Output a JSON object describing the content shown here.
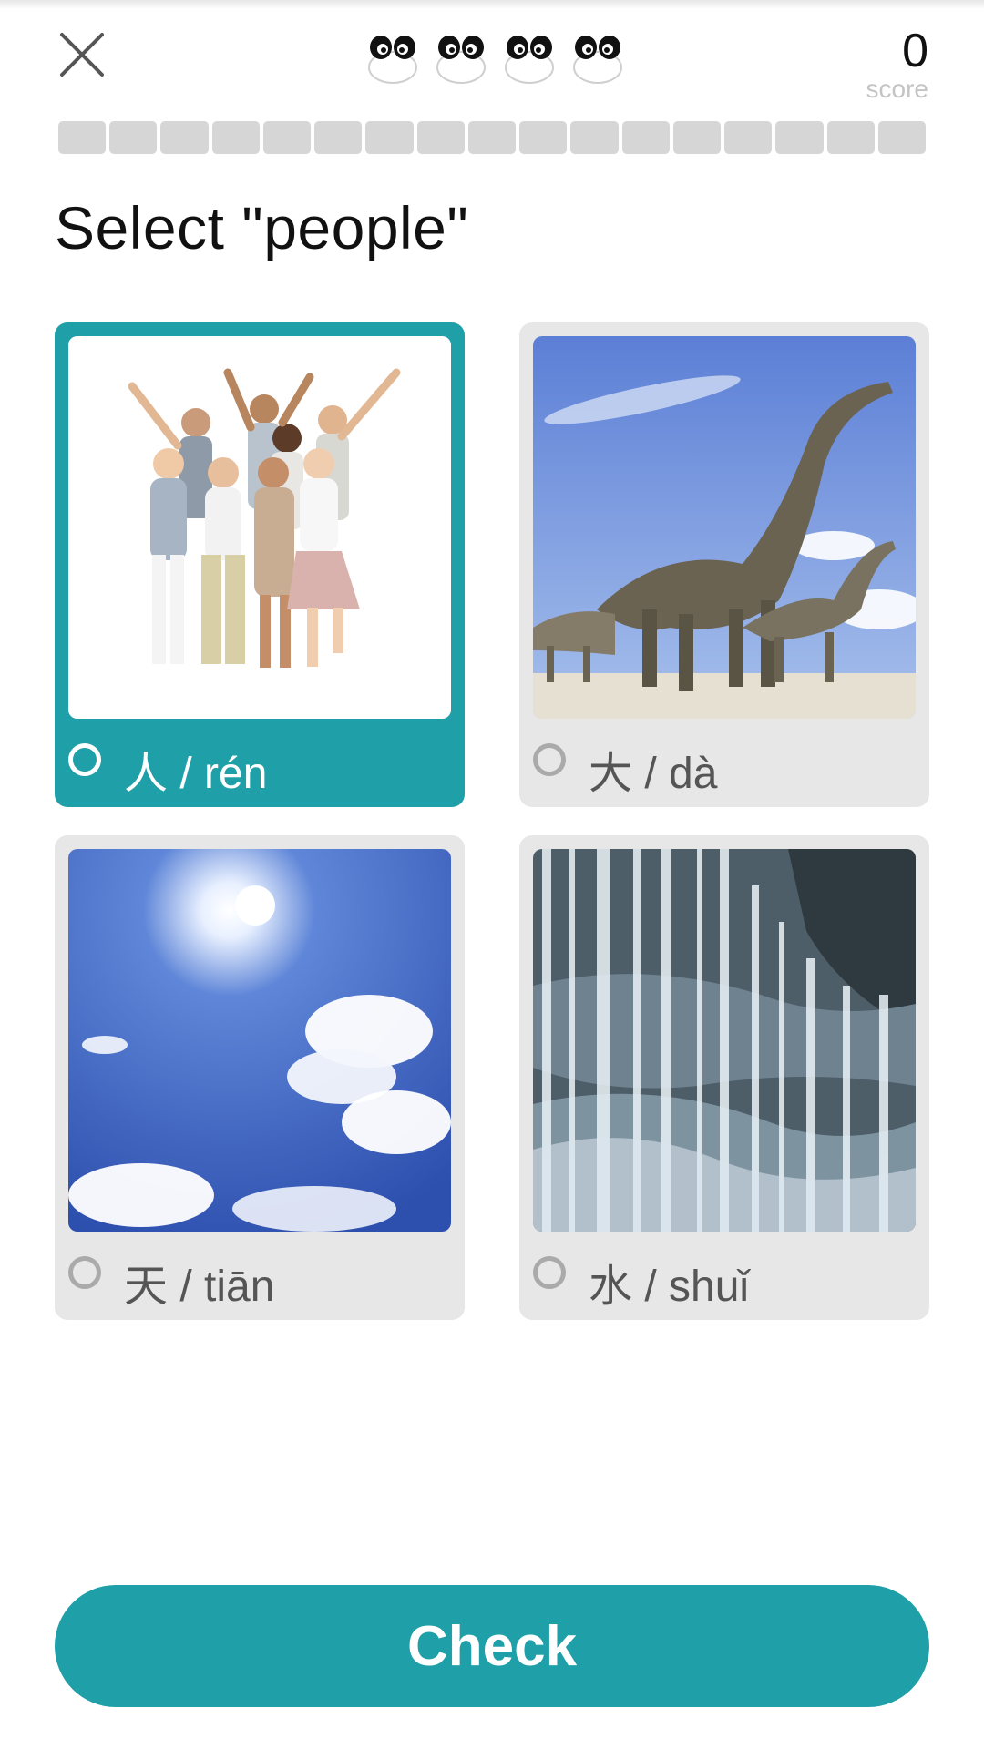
{
  "header": {
    "close_icon": "close-icon",
    "lives": {
      "count": 4,
      "icon": "panda-face-icon"
    },
    "score_value": "0",
    "score_label": "score"
  },
  "progress": {
    "segments": 17,
    "completed": 0
  },
  "question": {
    "text": "Select \"people\""
  },
  "options": [
    {
      "label": "人 / rén",
      "image": "people-photo",
      "selected": true
    },
    {
      "label": "大 / dà",
      "image": "dinosaurs-photo",
      "selected": false
    },
    {
      "label": "天 / tiān",
      "image": "sky-photo",
      "selected": false
    },
    {
      "label": "水 / shuǐ",
      "image": "waterfall-photo",
      "selected": false
    }
  ],
  "footer": {
    "check_label": "Check"
  },
  "colors": {
    "accent": "#1fa0a8",
    "card_bg": "#e7e7e7",
    "progress_empty": "#d6d6d6"
  }
}
